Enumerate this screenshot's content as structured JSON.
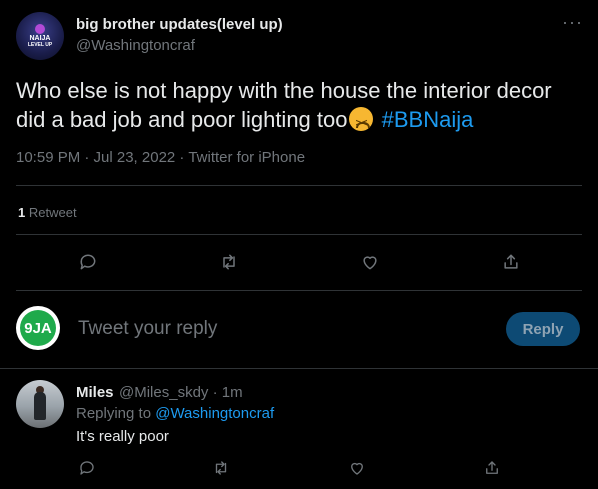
{
  "tweet": {
    "author": {
      "name": "big brother updates(level up)",
      "handle": "@Washingtoncraf",
      "avatar_text_line1": "NAIJA",
      "avatar_text_line2": "LEVEL UP"
    },
    "more_label": "···",
    "text_main": "Who else is not happy with the house the interior decor did a bad job and poor  lighting too",
    "hashtag": "#BBNaija",
    "timestamp": "10:59 PM · Jul 23, 2022 · Twitter for iPhone",
    "retweet_count": "1",
    "retweet_label": "Retweet",
    "actions": [
      "reply-icon",
      "retweet-icon",
      "like-icon",
      "share-icon"
    ]
  },
  "reply_composer": {
    "avatar_text": "9JA",
    "placeholder": "Tweet your reply",
    "button_label": "Reply"
  },
  "reply": {
    "name": "Miles",
    "handle_time": "@Miles_skdy · 1m",
    "replying_prefix": "Replying to",
    "replying_to": "@Washingtoncraf",
    "text": "It's really poor"
  },
  "colors": {
    "background": "#000000",
    "text": "#e7e9ea",
    "muted": "#71767b",
    "accent": "#1d9bf0",
    "divider": "#2f3336"
  }
}
